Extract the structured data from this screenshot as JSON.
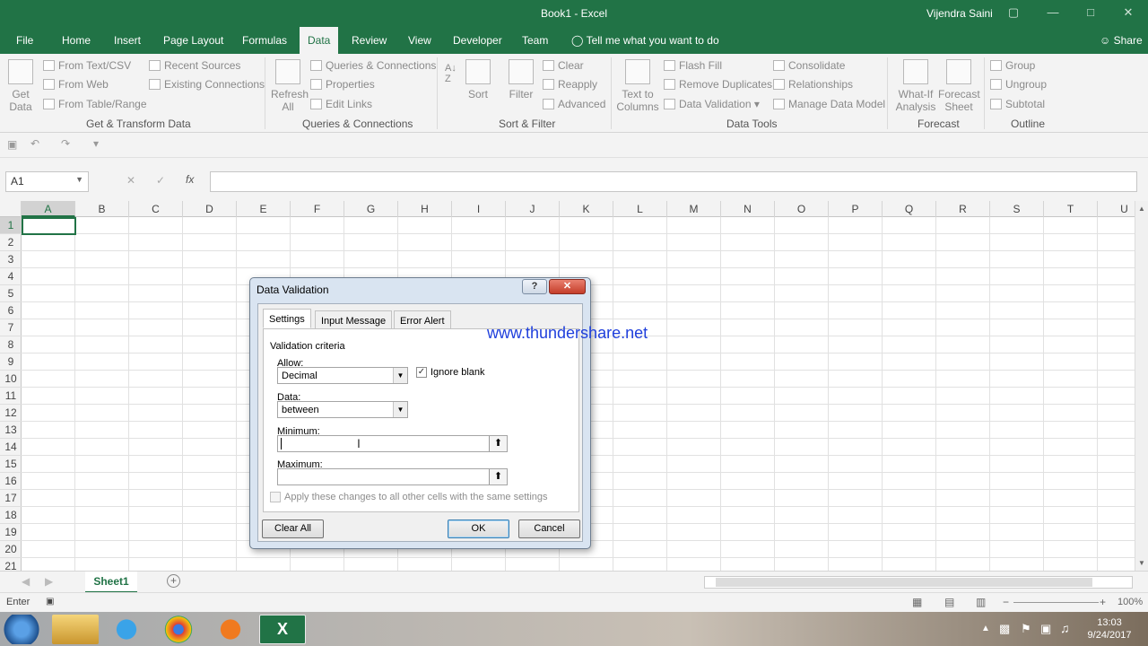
{
  "window": {
    "title": "Book1 - Excel",
    "user": "Vijendra Saini"
  },
  "tabs": [
    {
      "label": "File"
    },
    {
      "label": "Home"
    },
    {
      "label": "Insert"
    },
    {
      "label": "Page Layout"
    },
    {
      "label": "Formulas"
    },
    {
      "label": "Data"
    },
    {
      "label": "Review"
    },
    {
      "label": "View"
    },
    {
      "label": "Developer"
    },
    {
      "label": "Team"
    }
  ],
  "tell_me": "Tell me what you want to do",
  "share": "Share",
  "ribbon": {
    "get_transform": {
      "get_data": "Get\nData",
      "from_text": "From Text/CSV",
      "from_web": "From Web",
      "from_table": "From Table/Range",
      "recent_sources": "Recent Sources",
      "existing_connections": "Existing Connections",
      "group": "Get & Transform Data"
    },
    "queries": {
      "refresh_all": "Refresh\nAll",
      "queries_connections": "Queries & Connections",
      "properties": "Properties",
      "edit_links": "Edit Links",
      "group": "Queries & Connections"
    },
    "sort_filter": {
      "sort": "Sort",
      "filter": "Filter",
      "clear": "Clear",
      "reapply": "Reapply",
      "advanced": "Advanced",
      "group": "Sort & Filter"
    },
    "data_tools": {
      "text_to_columns": "Text to\nColumns",
      "flash_fill": "Flash Fill",
      "remove_duplicates": "Remove Duplicates",
      "data_validation": "Data Validation",
      "consolidate": "Consolidate",
      "relationships": "Relationships",
      "manage_data_model": "Manage Data Model",
      "group": "Data Tools"
    },
    "forecast": {
      "what_if": "What-If\nAnalysis",
      "forecast_sheet": "Forecast\nSheet",
      "group": "Forecast"
    },
    "outline": {
      "group_btn": "Group",
      "ungroup": "Ungroup",
      "subtotal": "Subtotal",
      "group": "Outline"
    }
  },
  "formula_bar": {
    "name_box": "A1",
    "fx": "fx",
    "value": ""
  },
  "columns": [
    "A",
    "B",
    "C",
    "D",
    "E",
    "F",
    "G",
    "H",
    "I",
    "J",
    "K",
    "L",
    "M",
    "N",
    "O",
    "P",
    "Q",
    "R",
    "S",
    "T",
    "U"
  ],
  "rows": [
    "1",
    "2",
    "3",
    "4",
    "5",
    "6",
    "7",
    "8",
    "9",
    "10",
    "11",
    "12",
    "13",
    "14",
    "15",
    "16",
    "17",
    "18",
    "19",
    "20",
    "21"
  ],
  "sheet_tab": "Sheet1",
  "status": {
    "mode": "Enter",
    "zoom": "100%"
  },
  "taskbar": {
    "time": "13:03",
    "date": "9/24/2017"
  },
  "dialog": {
    "title": "Data Validation",
    "help": "?",
    "tabs": [
      "Settings",
      "Input Message",
      "Error Alert"
    ],
    "section": "Validation criteria",
    "allow_label": "Allow:",
    "allow_value": "Decimal",
    "ignore_blank": "Ignore blank",
    "data_label": "Data:",
    "data_value": "between",
    "minimum_label": "Minimum:",
    "maximum_label": "Maximum:",
    "apply_all": "Apply these changes to all other cells with the same settings",
    "clear_all": "Clear All",
    "ok": "OK",
    "cancel": "Cancel"
  },
  "watermark": "www.thundershare.net"
}
